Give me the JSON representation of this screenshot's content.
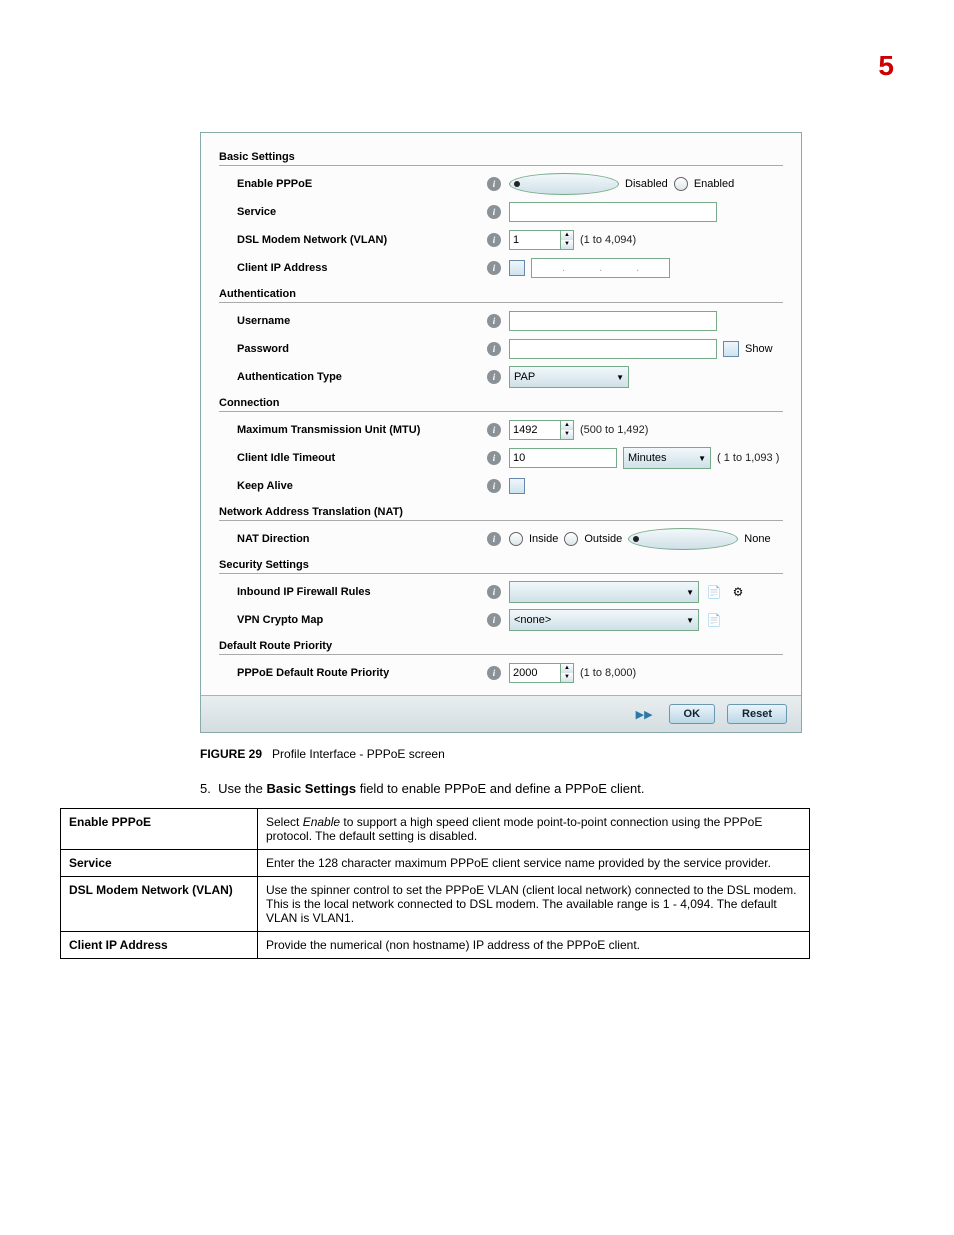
{
  "chapter_number": "5",
  "panel": {
    "groups": {
      "basic": "Basic Settings",
      "auth": "Authentication",
      "conn": "Connection",
      "nat": "Network Address Translation (NAT)",
      "sec": "Security Settings",
      "route": "Default Route Priority"
    },
    "labels": {
      "enable_pppoe": "Enable PPPoE",
      "service": "Service",
      "dsl_vlan": "DSL Modem Network (VLAN)",
      "client_ip": "Client IP Address",
      "username": "Username",
      "password": "Password",
      "auth_type": "Authentication Type",
      "mtu": "Maximum Transmission Unit (MTU)",
      "idle": "Client Idle Timeout",
      "keepalive": "Keep Alive",
      "nat_dir": "NAT Direction",
      "firewall": "Inbound IP Firewall Rules",
      "vpn": "VPN Crypto Map",
      "route_pri": "PPPoE Default Route Priority"
    },
    "radios": {
      "disabled": "Disabled",
      "enabled": "Enabled",
      "inside": "Inside",
      "outside": "Outside",
      "none": "None"
    },
    "values": {
      "vlan": "1",
      "auth_type": "PAP",
      "mtu": "1492",
      "idle": "10",
      "idle_unit": "Minutes",
      "vpn": "<none>",
      "route_pri": "2000",
      "show": "Show"
    },
    "hints": {
      "vlan": "(1 to 4,094)",
      "mtu": "(500 to 1,492)",
      "idle": "( 1 to 1,093 )",
      "route": "(1 to 8,000)"
    },
    "buttons": {
      "ok": "OK",
      "reset": "Reset"
    }
  },
  "figure": {
    "label": "FIGURE 29",
    "caption": "Profile Interface - PPPoE screen"
  },
  "step": {
    "num": "5.",
    "pre": "Use the ",
    "bold": "Basic Settings",
    "post": " field to enable PPPoE and define a PPPoE client."
  },
  "table": {
    "r1": {
      "h": "Enable PPPoE",
      "pre": "Select ",
      "it": "Enable",
      "post": " to support a high speed client mode point-to-point connection using the PPPoE protocol. The default setting is disabled."
    },
    "r2": {
      "h": "Service",
      "d": "Enter the 128 character maximum PPPoE client service name provided by the service provider."
    },
    "r3": {
      "h": "DSL Modem Network (VLAN)",
      "d": "Use the spinner control to set the PPPoE VLAN (client local network) connected to the DSL modem. This is the local network connected to DSL modem. The available range is 1 - 4,094. The default VLAN is VLAN1."
    },
    "r4": {
      "h": "Client IP Address",
      "d": "Provide the numerical (non hostname) IP address of the PPPoE client."
    }
  }
}
